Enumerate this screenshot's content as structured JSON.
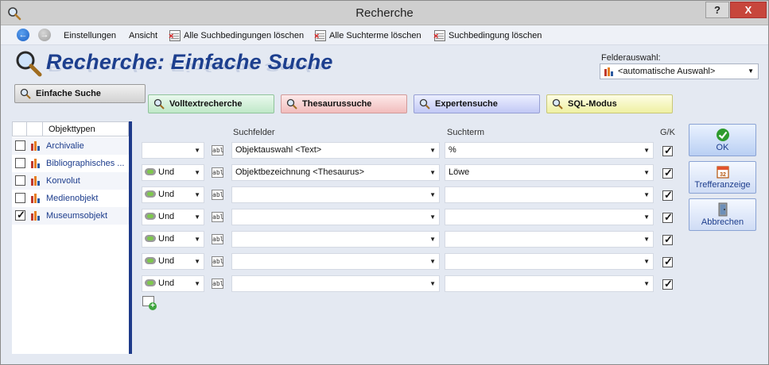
{
  "window": {
    "title": "Recherche",
    "help_label": "?",
    "close_label": "X"
  },
  "toolbar": {
    "back_glyph": "←",
    "forward_glyph": "→",
    "settings_label": "Einstellungen",
    "view_label": "Ansicht",
    "clear_conditions_label": "Alle Suchbedingungen löschen",
    "clear_terms_label": "Alle Suchterme löschen",
    "delete_condition_label": "Suchbedingung löschen"
  },
  "header": {
    "title": "Recherche: Einfache Suche"
  },
  "field_selection": {
    "label": "Felderauswahl:",
    "value": "<automatische Auswahl>"
  },
  "tabs": [
    {
      "label": "Einfache Suche",
      "color": "#d2d2d2"
    },
    {
      "label": "Volltextrecherche",
      "color": "#bfe8c8"
    },
    {
      "label": "Thesaurussuche",
      "color": "#f1bcbc"
    },
    {
      "label": "Expertensuche",
      "color": "#c1c8f5"
    },
    {
      "label": "SQL-Modus",
      "color": "#eff0a2"
    }
  ],
  "object_types": {
    "header": "Objekttypen",
    "items": [
      {
        "label": "Archivalie",
        "checked": false
      },
      {
        "label": "Bibliographisches ...",
        "checked": false
      },
      {
        "label": "Konvolut",
        "checked": false
      },
      {
        "label": "Medienobjekt",
        "checked": false
      },
      {
        "label": "Museumsobjekt",
        "checked": true
      }
    ]
  },
  "conditions": {
    "col_fields": "Suchfelder",
    "col_term": "Suchterm",
    "col_gk": "G/K",
    "rows": [
      {
        "operator": "",
        "field": "Objektauswahl <Text>",
        "term": "%",
        "gk": true
      },
      {
        "operator": "Und",
        "field": "Objektbezeichnung <Thesaurus>",
        "term": "Löwe",
        "gk": true
      },
      {
        "operator": "Und",
        "field": "",
        "term": "",
        "gk": true
      },
      {
        "operator": "Und",
        "field": "",
        "term": "",
        "gk": true
      },
      {
        "operator": "Und",
        "field": "",
        "term": "",
        "gk": true
      },
      {
        "operator": "Und",
        "field": "",
        "term": "",
        "gk": true
      },
      {
        "operator": "Und",
        "field": "",
        "term": "",
        "gk": true
      }
    ]
  },
  "buttons": {
    "ok": "OK",
    "hits": "Trefferanzeige",
    "cancel": "Abbrechen"
  },
  "colors": {
    "heading": "#1d3f8e",
    "link_text": "#1c3c8c",
    "panel_bar": "#1e3a8a"
  }
}
